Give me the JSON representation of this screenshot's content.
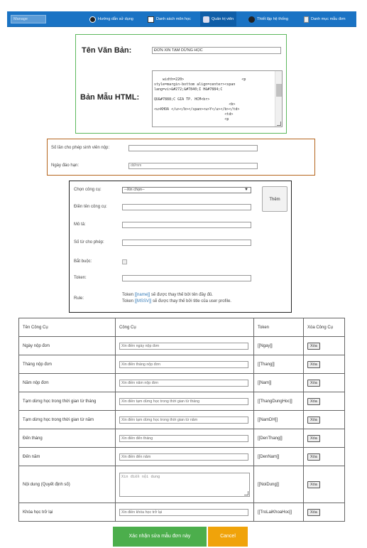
{
  "nav": {
    "manage_label": "Manage",
    "items": [
      {
        "label": "Hướng dẫn sử dụng",
        "icon": "help-icon"
      },
      {
        "label": "Danh sách môn học",
        "icon": "list-icon"
      },
      {
        "label": "Quản trị viên",
        "icon": "admin-icon"
      },
      {
        "label": "Thiết lập hệ thống",
        "icon": "settings-icon"
      },
      {
        "label": "Danh mục mẫu đơn",
        "icon": "form-icon"
      }
    ]
  },
  "template": {
    "name_label": "Tên Văn Bản:",
    "name_value": "ĐƠN XIN TẠM DỪNG HỌC",
    "html_label": "Bản Mẫu HTML:",
    "html_value": "width=220>                           <p\nstyle=margin-bottom align=center><span\nlang=vi>&#272;&#7840;I H&#7884;C\n\nQU&#7888;C GIA TP. HCM<br>\n                                   <b>\n<u>KHOA </u></b></span><u>Y</u></b></td>\n                                 <td>\n                                 <p"
  },
  "limits": {
    "attempts_label": "Số lần cho phép sinh viên nộp:",
    "attempts_value": "",
    "deadline_label": "Ngày đáo hạn:",
    "deadline_placeholder": "dd/mm"
  },
  "tool_form": {
    "select_label": "Chọn công cụ:",
    "select_value": "--Xin chọn--",
    "add_label": "Thêm",
    "name_label": "Điền tên công cụ:",
    "desc_label": "Mô tả:",
    "words_label": "Số từ cho phép:",
    "required_label": "Bắt buộc:",
    "token_label": "Token:",
    "rule_label": "Rule:",
    "rule_line1_pre": "Token ",
    "rule_line1_tok": "[[name]]",
    "rule_line1_post": " sẽ được thay thế bởi tên đầy đủ.",
    "rule_line2_pre": "Token ",
    "rule_line2_tok": "[[MSSV]]",
    "rule_line2_post": " sẽ được thay thế bởi title của user profile."
  },
  "table": {
    "headers": [
      "Tên Công Cụ",
      "Công Cụ",
      "Token",
      "Xóa Công Cụ"
    ],
    "delete_label": "Xóa",
    "rows": [
      {
        "name": "Ngày nộp đơn",
        "placeholder": "Xin điền ngày nộp đơn",
        "token": "[[Ngay]]"
      },
      {
        "name": "Tháng nộp đơn",
        "placeholder": "Xin điền tháng nộp đơn",
        "token": "[[Thang]]"
      },
      {
        "name": "Năm nộp đơn",
        "placeholder": "Xin điền năm nộp đơn",
        "token": "[[Nam]]"
      },
      {
        "name": "Tạm dừng học trong thời gian từ tháng",
        "placeholder": "Xin điền tạm dừng học trong thời gian từ tháng",
        "token": "[[ThangDungHoc]]"
      },
      {
        "name": "Tạm dừng học trong thời gian từ năm",
        "placeholder": "Xin điền tạm dừng học trong thời gian từ năm",
        "token": "[[NamDH]]"
      },
      {
        "name": "Đến tháng",
        "placeholder": "Xin điền đến tháng",
        "token": "[[DenThang]]"
      },
      {
        "name": "Đến năm",
        "placeholder": "Xin điền đến năm",
        "token": "[[DenNam]]"
      },
      {
        "name": "Nội dung (Quyết định số)",
        "placeholder": "Xin điền nội dung",
        "token": "[[NoiDung]]"
      },
      {
        "name": "Khóa học trở lại",
        "placeholder": "Xin điền khóa học trở lại",
        "token": "[[TroLaiKhoaHoc]]"
      }
    ]
  },
  "actions": {
    "confirm_label": "Xác nhận sửa mẫu đơn này",
    "cancel_label": "Cancel"
  }
}
